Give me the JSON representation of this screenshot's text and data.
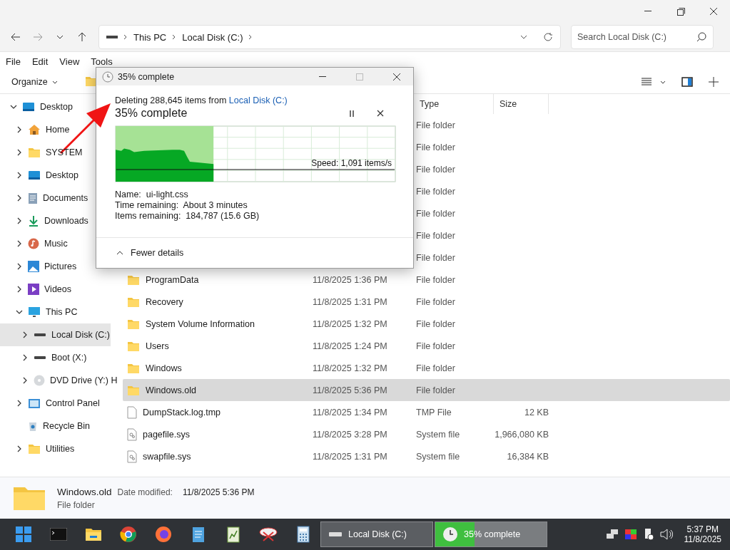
{
  "address": {
    "crumbs": [
      "This PC",
      "Local Disk (C:)"
    ]
  },
  "search": {
    "placeholder": "Search Local Disk (C:)"
  },
  "menu": [
    "File",
    "Edit",
    "View",
    "Tools"
  ],
  "toolbar": {
    "organize": "Organize"
  },
  "sidebar": {
    "items": [
      {
        "label": "Desktop",
        "kind": "desktop",
        "expanded": true,
        "selected": false,
        "children": [
          {
            "label": "Home",
            "kind": "home",
            "expanded": false,
            "selected": false
          },
          {
            "label": "SYSTEM",
            "kind": "folder",
            "expanded": false,
            "selected": false
          },
          {
            "label": "Desktop",
            "kind": "desktop",
            "expanded": false,
            "selected": false
          },
          {
            "label": "Documents",
            "kind": "documents",
            "expanded": false,
            "selected": false
          },
          {
            "label": "Downloads",
            "kind": "downloads",
            "expanded": false,
            "selected": false
          },
          {
            "label": "Music",
            "kind": "music",
            "expanded": false,
            "selected": false
          },
          {
            "label": "Pictures",
            "kind": "pictures",
            "expanded": false,
            "selected": false
          },
          {
            "label": "Videos",
            "kind": "videos",
            "expanded": false,
            "selected": false
          },
          {
            "label": "This PC",
            "kind": "pc",
            "expanded": true,
            "selected": false,
            "children": [
              {
                "label": "Local Disk (C:)",
                "kind": "drive",
                "expanded": false,
                "selected": true
              },
              {
                "label": "Boot (X:)",
                "kind": "drive",
                "expanded": false,
                "selected": false
              },
              {
                "label": "DVD Drive (Y:) H",
                "kind": "dvd",
                "expanded": false,
                "selected": false
              }
            ]
          },
          {
            "label": "Control Panel",
            "kind": "control",
            "expanded": false,
            "selected": false
          },
          {
            "label": "Recycle Bin",
            "kind": "recycle",
            "selected": false
          },
          {
            "label": "Utilities",
            "kind": "folder",
            "expanded": false,
            "selected": false
          }
        ]
      }
    ]
  },
  "table": {
    "columns": [
      "Type",
      "Size"
    ],
    "rows": [
      {
        "kind": "folder",
        "type": "File folder",
        "selected": false
      },
      {
        "kind": "folder",
        "type": "File folder",
        "selected": false
      },
      {
        "kind": "folder",
        "type": "File folder",
        "selected": false
      },
      {
        "kind": "folder",
        "type": "File folder",
        "selected": false
      },
      {
        "kind": "folder",
        "type": "File folder",
        "selected": false
      },
      {
        "kind": "folder",
        "type": "File folder",
        "selected": false
      },
      {
        "kind": "folder",
        "type": "File folder",
        "selected": false
      },
      {
        "kind": "folder",
        "name": "ProgramData",
        "date": "11/8/2025 1:36 PM",
        "type": "File folder",
        "selected": false
      },
      {
        "kind": "folder",
        "name": "Recovery",
        "date": "11/8/2025 1:31 PM",
        "type": "File folder",
        "selected": false
      },
      {
        "kind": "folder",
        "name": "System Volume Information",
        "date": "11/8/2025 1:32 PM",
        "type": "File folder",
        "selected": false
      },
      {
        "kind": "folder",
        "name": "Users",
        "date": "11/8/2025 1:24 PM",
        "type": "File folder",
        "selected": false
      },
      {
        "kind": "folder",
        "name": "Windows",
        "date": "11/8/2025 1:32 PM",
        "type": "File folder",
        "selected": false
      },
      {
        "kind": "folder",
        "name": "Windows.old",
        "date": "11/8/2025 5:36 PM",
        "type": "File folder",
        "selected": true
      },
      {
        "kind": "file",
        "name": "DumpStack.log.tmp",
        "date": "11/8/2025 1:34 PM",
        "type": "TMP File",
        "size": "12 KB",
        "selected": false
      },
      {
        "kind": "sysfile",
        "name": "pagefile.sys",
        "date": "11/8/2025 3:28 PM",
        "type": "System file",
        "size": "1,966,080 KB",
        "selected": false
      },
      {
        "kind": "sysfile",
        "name": "swapfile.sys",
        "date": "11/8/2025 1:31 PM",
        "type": "System file",
        "size": "16,384 KB",
        "selected": false
      }
    ]
  },
  "details": {
    "name": "Windows.old",
    "date_label": "Date modified:",
    "date": "11/8/2025 5:36 PM",
    "type": "File folder"
  },
  "dialog": {
    "title": "35% complete",
    "message": "Deleting 288,645 items from ",
    "link": "Local Disk (C:)",
    "heading": "35% complete",
    "level": 0.35,
    "speed": "Speed: 1,091 items/s",
    "info": [
      {
        "label": "Name:",
        "value": "ui-light.css"
      },
      {
        "label": "Time remaining:",
        "value": "About 3 minutes"
      },
      {
        "label": "Items remaining:",
        "value": "184,787 (15.6 GB)"
      }
    ],
    "toggle": "Fewer details"
  },
  "taskbar": {
    "tasks": [
      {
        "kind": "drive",
        "label": "Local Disk (C:)",
        "selected": false
      },
      {
        "kind": "progress",
        "label": "35% complete",
        "selected": true,
        "level": 0.35
      }
    ],
    "time": "5:37 PM",
    "date": "11/8/2025"
  }
}
